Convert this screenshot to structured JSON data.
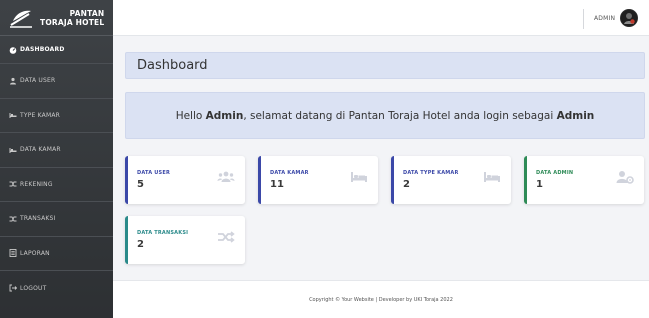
{
  "brand": {
    "line1": "PANTAN",
    "line2": "TORAJA HOTEL"
  },
  "sidebar": {
    "items": [
      {
        "label": "DASHBOARD",
        "icon": "dashboard-icon"
      },
      {
        "label": "DATA USER",
        "icon": "user-icon"
      },
      {
        "label": "TYPE KAMAR",
        "icon": "bed-icon"
      },
      {
        "label": "DATA KAMAR",
        "icon": "bed-icon"
      },
      {
        "label": "REKENING",
        "icon": "shuffle-icon"
      },
      {
        "label": "TRANSAKSI",
        "icon": "shuffle-icon"
      },
      {
        "label": "LAPORAN",
        "icon": "report-icon"
      },
      {
        "label": "LOGOUT",
        "icon": "logout-icon"
      }
    ]
  },
  "topbar": {
    "user": "ADMIN"
  },
  "page": {
    "title": "Dashboard"
  },
  "welcome": {
    "pre": "Hello ",
    "name": "Admin",
    "mid": ", selamat datang di Pantan Toraja Hotel anda login sebagai ",
    "role": "Admin"
  },
  "cards": [
    {
      "label": "DATA USER",
      "value": "5",
      "icon": "users-icon",
      "color": "#3b48a8"
    },
    {
      "label": "DATA KAMAR",
      "value": "11",
      "icon": "bed-icon",
      "color": "#3b48a8"
    },
    {
      "label": "DATA TYPE KAMAR",
      "value": "2",
      "icon": "bed-icon",
      "color": "#3b48a8"
    },
    {
      "label": "DATA ADMIN",
      "value": "1",
      "icon": "user-cog-icon",
      "color": "#2e8b57"
    },
    {
      "label": "DATA TRANSAKSI",
      "value": "2",
      "icon": "shuffle-icon",
      "color": "#2a8a8a"
    }
  ],
  "footer": {
    "text": "Copyright © Your Website | Developer by UKI Toraja 2022"
  }
}
